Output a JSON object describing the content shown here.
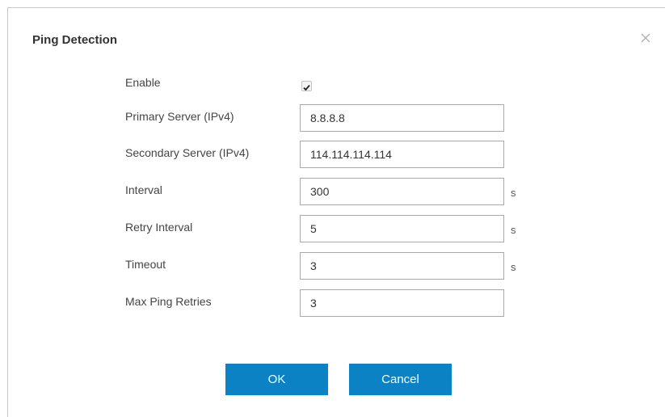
{
  "dialog": {
    "title": "Ping Detection",
    "close_icon": "close-icon"
  },
  "form": {
    "enable": {
      "label": "Enable",
      "checked": true
    },
    "primary_server": {
      "label": "Primary Server (IPv4)",
      "value": "8.8.8.8"
    },
    "secondary_server": {
      "label": "Secondary Server (IPv4)",
      "value": "114.114.114.114"
    },
    "interval": {
      "label": "Interval",
      "value": "300",
      "unit": "s"
    },
    "retry_interval": {
      "label": "Retry Interval",
      "value": "5",
      "unit": "s"
    },
    "timeout": {
      "label": "Timeout",
      "value": "3",
      "unit": "s"
    },
    "max_ping_retries": {
      "label": "Max Ping Retries",
      "value": "3"
    }
  },
  "buttons": {
    "ok_label": "OK",
    "cancel_label": "Cancel"
  },
  "colors": {
    "button_bg": "#0a82c4",
    "button_text": "#ffffff",
    "title_text": "#333333"
  }
}
